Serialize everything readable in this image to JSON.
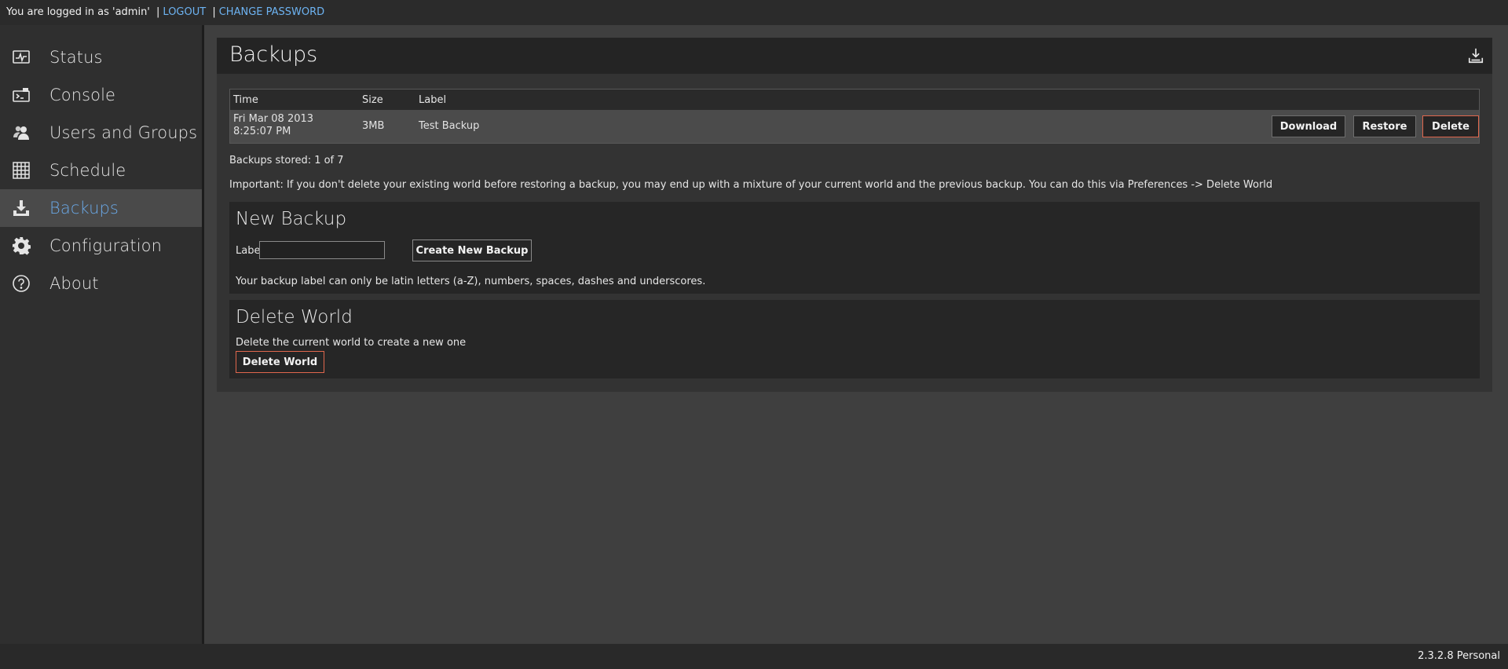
{
  "topbar": {
    "logged_in_text": "You are logged in as 'admin'",
    "separator": "|",
    "logout_label": "LOGOUT",
    "change_password_label": "CHANGE PASSWORD"
  },
  "sidebar": {
    "items": [
      {
        "label": "Status",
        "icon": "pulse-monitor-icon"
      },
      {
        "label": "Console",
        "icon": "console-icon"
      },
      {
        "label": "Users and Groups",
        "icon": "users-icon"
      },
      {
        "label": "Schedule",
        "icon": "calendar-grid-icon"
      },
      {
        "label": "Backups",
        "icon": "download-tray-icon",
        "active": true
      },
      {
        "label": "Configuration",
        "icon": "gear-icon"
      },
      {
        "label": "About",
        "icon": "question-circle-icon"
      }
    ]
  },
  "main": {
    "title": "Backups",
    "table": {
      "headers": [
        "Time",
        "Size",
        "Label"
      ],
      "rows": [
        {
          "time": "Fri Mar 08 2013 8:25:07 PM",
          "size": "3MB",
          "label": "Test Backup"
        }
      ],
      "actions": {
        "download": "Download",
        "restore": "Restore",
        "delete": "Delete"
      }
    },
    "stored_text": "Backups stored: 1 of 7",
    "important_text": "Important: If you don't delete your existing world before restoring a backup, you may end up with a mixture of your current world and the previous backup. You can do this via Preferences -> Delete World",
    "new_backup": {
      "title": "New Backup",
      "label_caption": "Label:",
      "input_value": "",
      "create_button": "Create New Backup",
      "hint": "Your backup label can only be latin letters (a-Z), numbers, spaces, dashes and underscores."
    },
    "delete_world": {
      "title": "Delete World",
      "description": "Delete the current world to create a new one",
      "button": "Delete World"
    }
  },
  "footer": {
    "version": "2.3.2.8 Personal"
  },
  "colors": {
    "accent": "#6aa8e6",
    "link": "#6db3f2",
    "danger_border": "#e0674d"
  }
}
